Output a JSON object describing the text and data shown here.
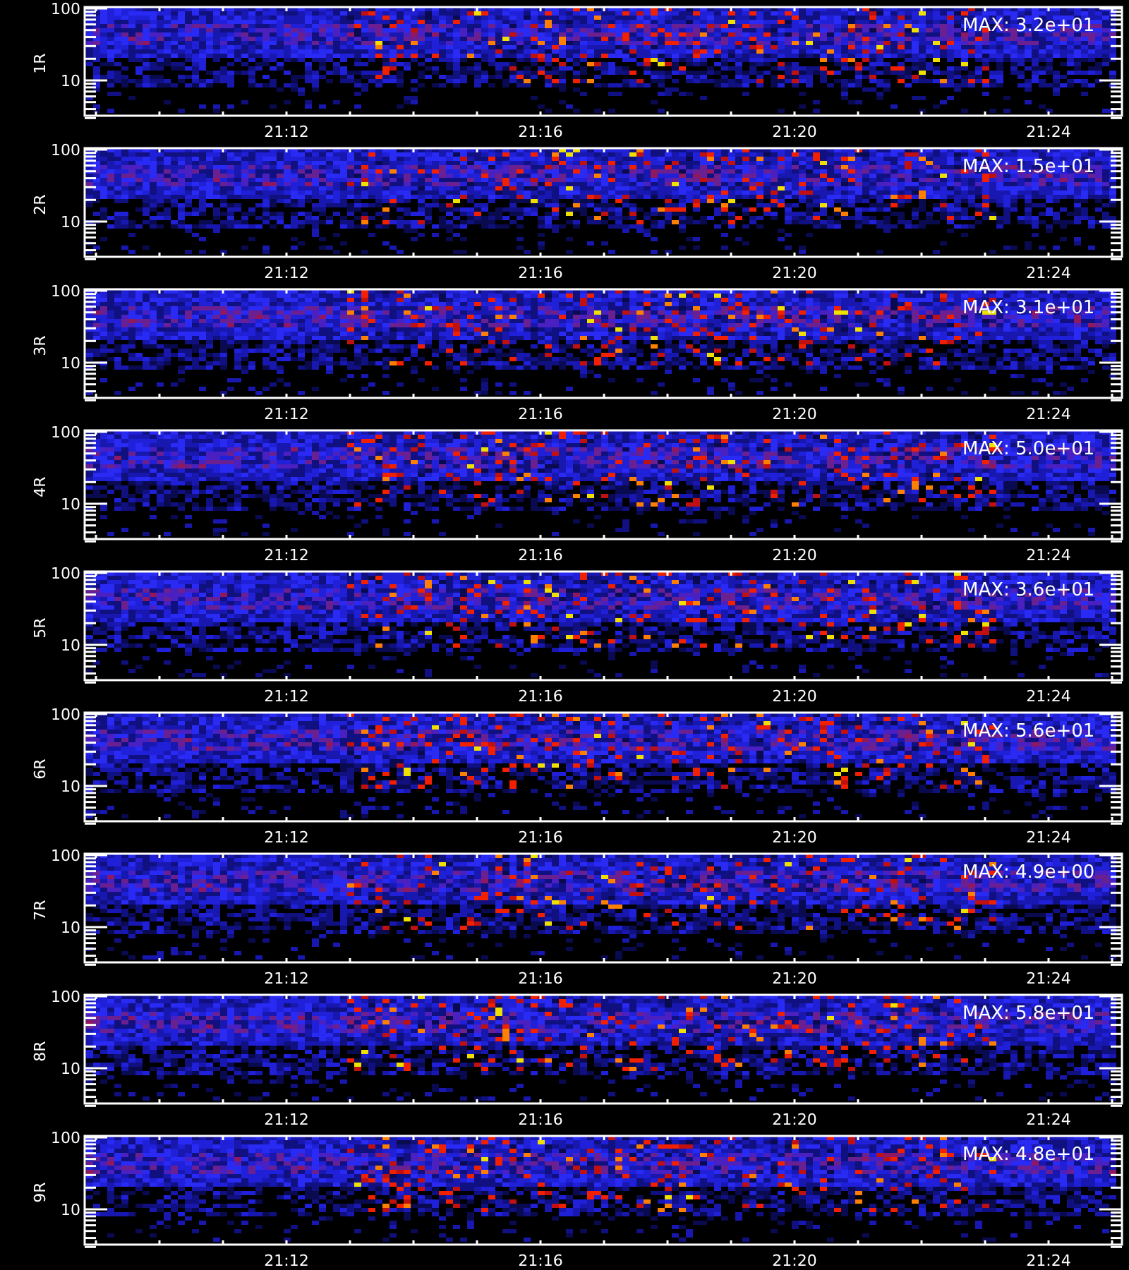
{
  "panels": [
    {
      "channel": "1R",
      "max": "MAX: 3.2e+01",
      "y_ticks": [
        "100",
        "10"
      ],
      "x_ticks": [
        "21:12",
        "21:16",
        "21:20",
        "21:24"
      ]
    },
    {
      "channel": "2R",
      "max": "MAX: 1.5e+01",
      "y_ticks": [
        "100",
        "10"
      ],
      "x_ticks": [
        "21:12",
        "21:16",
        "21:20",
        "21:24"
      ]
    },
    {
      "channel": "3R",
      "max": "MAX: 3.1e+01",
      "y_ticks": [
        "100",
        "10"
      ],
      "x_ticks": [
        "21:12",
        "21:16",
        "21:20",
        "21:24"
      ]
    },
    {
      "channel": "4R",
      "max": "MAX: 5.0e+01",
      "y_ticks": [
        "100",
        "10"
      ],
      "x_ticks": [
        "21:12",
        "21:16",
        "21:20",
        "21:24"
      ]
    },
    {
      "channel": "5R",
      "max": "MAX: 3.6e+01",
      "y_ticks": [
        "100",
        "10"
      ],
      "x_ticks": [
        "21:12",
        "21:16",
        "21:20",
        "21:24"
      ]
    },
    {
      "channel": "6R",
      "max": "MAX: 5.6e+01",
      "y_ticks": [
        "100",
        "10"
      ],
      "x_ticks": [
        "21:12",
        "21:16",
        "21:20",
        "21:24"
      ]
    },
    {
      "channel": "7R",
      "max": "MAX: 4.9e+00",
      "y_ticks": [
        "100",
        "10"
      ],
      "x_ticks": [
        "21:12",
        "21:16",
        "21:20",
        "21:24"
      ]
    },
    {
      "channel": "8R",
      "max": "MAX: 5.8e+01",
      "y_ticks": [
        "100",
        "10"
      ],
      "x_ticks": [
        "21:12",
        "21:16",
        "21:20",
        "21:24"
      ]
    },
    {
      "channel": "9R",
      "max": "MAX: 4.8e+01",
      "y_ticks": [
        "100",
        "10"
      ],
      "x_ticks": [
        "21:12",
        "21:16",
        "21:20",
        "21:24"
      ]
    }
  ]
}
